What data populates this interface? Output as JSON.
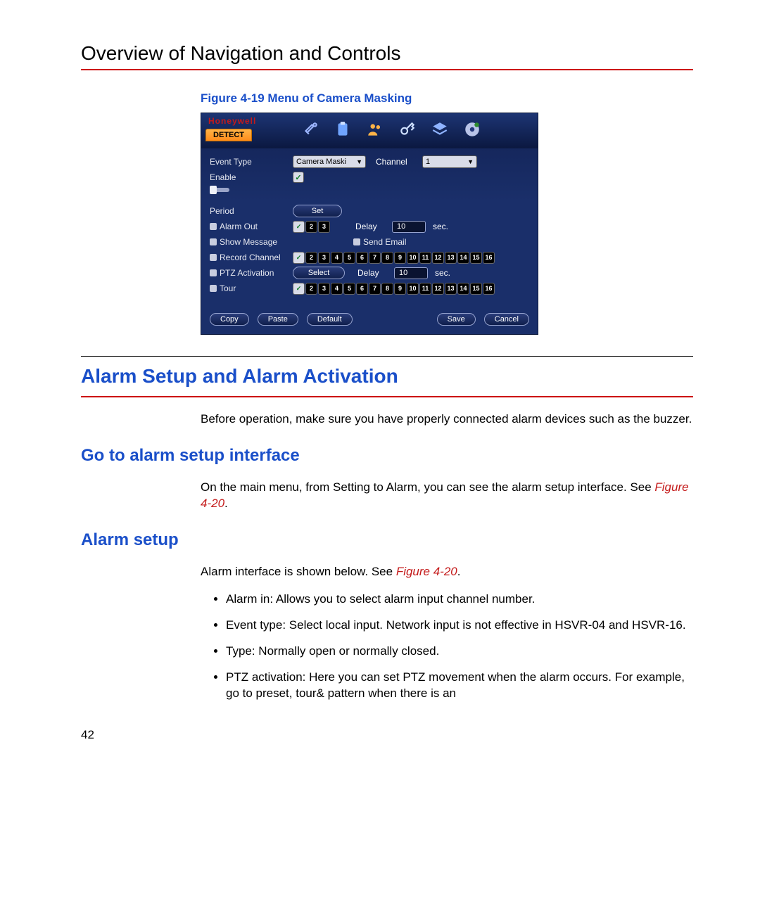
{
  "page": {
    "title": "Overview of Navigation and Controls",
    "figure_caption": "Figure 4-19 Menu of Camera Masking",
    "section_title": "Alarm Setup and Alarm Activation",
    "intro_paragraph": "Before operation, make sure you have properly connected alarm devices such as the buzzer.",
    "sub1_title": "Go to alarm setup interface",
    "sub1_text_a": "On the main menu, from Setting to Alarm, you can see the alarm setup interface. See ",
    "sub1_ref": "Figure 4-20",
    "sub1_text_b": ".",
    "sub2_title": "Alarm setup",
    "sub2_text_a": "Alarm interface is shown below. See ",
    "sub2_ref": "Figure 4-20",
    "sub2_text_b": ".",
    "bullets": [
      "Alarm in: Allows you to select alarm input channel number.",
      "Event type: Select local input. Network input is not effective in HSVR-04 and HSVR-16.",
      "Type: Normally open or normally closed.",
      "PTZ activation: Here you can set PTZ movement when the alarm occurs. For example, go to preset, tour& pattern when there is an"
    ],
    "page_number": "42"
  },
  "dvr": {
    "brand": "Honeywell",
    "tab": "DETECT",
    "labels": {
      "event_type": "Event Type",
      "enable": "Enable",
      "period": "Period",
      "alarm_out": "Alarm Out",
      "show_message": "Show Message",
      "record_channel": "Record Channel",
      "ptz_activation": "PTZ Activation",
      "tour": "Tour",
      "channel": "Channel",
      "delay": "Delay",
      "send_email": "Send Email",
      "sec": "sec."
    },
    "values": {
      "event_type": "Camera Maski",
      "channel": "1",
      "delay1": "10",
      "delay2": "10"
    },
    "buttons": {
      "set": "Set",
      "select": "Select",
      "copy": "Copy",
      "paste": "Paste",
      "default": "Default",
      "save": "Save",
      "cancel": "Cancel"
    },
    "alarm_out": [
      "1",
      "2",
      "3"
    ],
    "channels16": [
      "1",
      "2",
      "3",
      "4",
      "5",
      "6",
      "7",
      "8",
      "9",
      "10",
      "11",
      "12",
      "13",
      "14",
      "15",
      "16"
    ]
  }
}
